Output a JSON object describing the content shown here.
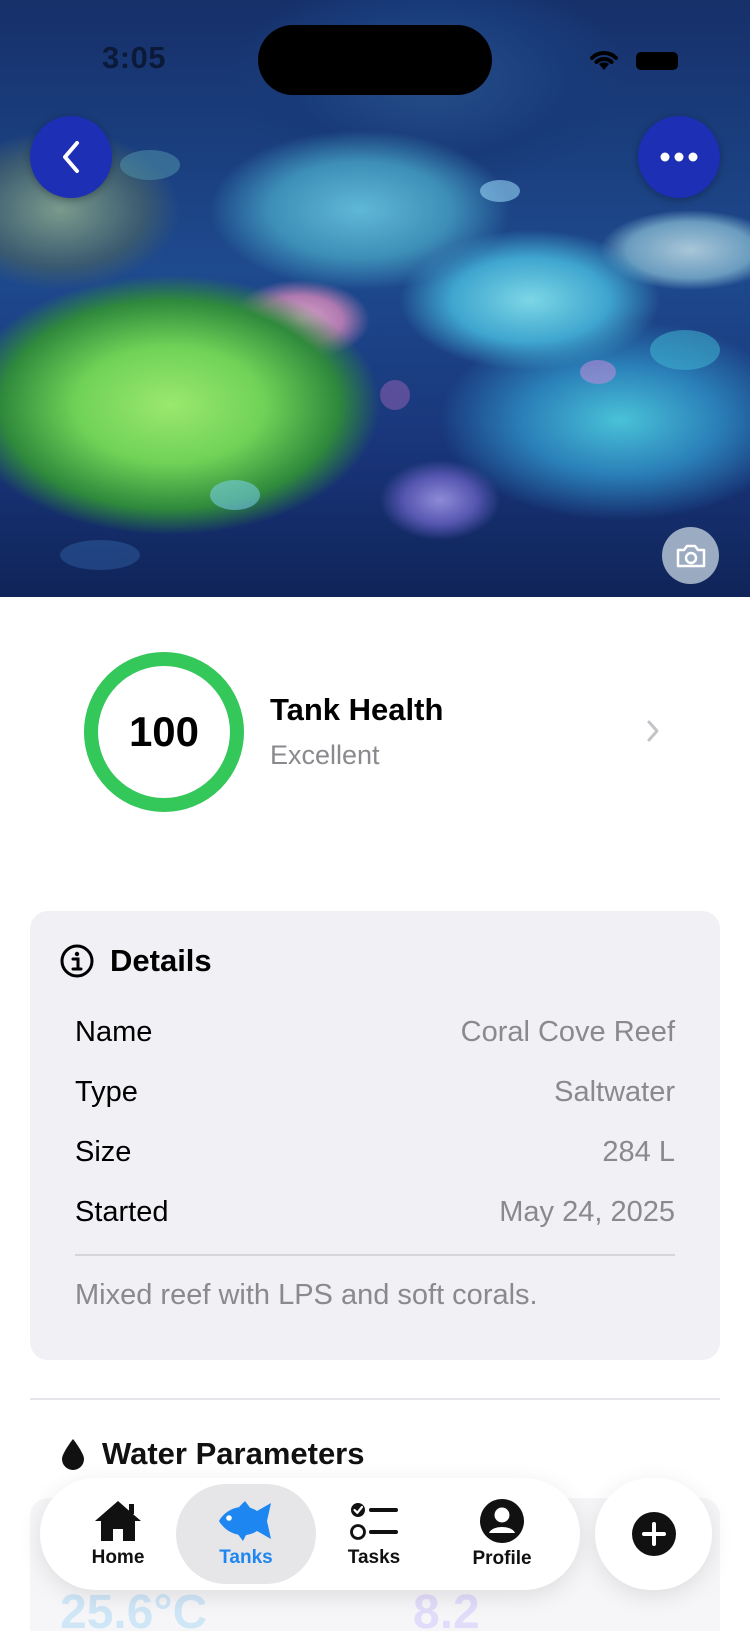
{
  "status_bar": {
    "time": "3:05"
  },
  "hero": {
    "image_alt": "Reef tank coral photo",
    "back_icon": "chevron-left-icon",
    "more_icon": "ellipsis-icon",
    "camera_icon": "camera-icon"
  },
  "health": {
    "score": "100",
    "score_fraction": 1.0,
    "title": "Tank Health",
    "status": "Excellent",
    "ring_color": "#34c759"
  },
  "details": {
    "title": "Details",
    "rows": [
      {
        "key": "Name",
        "value": "Coral Cove Reef"
      },
      {
        "key": "Type",
        "value": "Saltwater"
      },
      {
        "key": "Size",
        "value": "284 L"
      },
      {
        "key": "Started",
        "value": "May 24, 2025"
      }
    ],
    "description": "Mixed reef with LPS and soft corals."
  },
  "water_parameters": {
    "title": "Water Parameters",
    "temperature": "25.6°C",
    "ph": "8.2"
  },
  "tabbar": {
    "items": [
      {
        "label": "Home",
        "icon": "house-icon"
      },
      {
        "label": "Tanks",
        "icon": "fish-icon"
      },
      {
        "label": "Tasks",
        "icon": "checklist-icon"
      },
      {
        "label": "Profile",
        "icon": "person-icon"
      }
    ],
    "active": "Tanks",
    "accent": "#1e86f0"
  },
  "fab": {
    "icon": "plus-icon"
  }
}
